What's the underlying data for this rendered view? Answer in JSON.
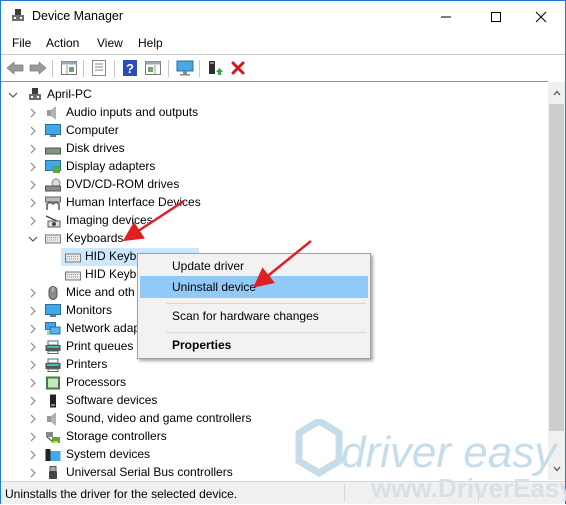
{
  "window": {
    "title": "Device Manager",
    "controls": {
      "minimize": "minimize-icon",
      "maximize": "maximize-icon",
      "close": "close-icon"
    }
  },
  "menubar": {
    "items": [
      "File",
      "Action",
      "View",
      "Help"
    ]
  },
  "toolbar": {
    "buttons": [
      {
        "icon": "back-arrow-icon",
        "tooltip": "Back"
      },
      {
        "icon": "forward-arrow-icon",
        "tooltip": "Forward"
      },
      {
        "icon": "show-hide-console-tree-icon",
        "tooltip": "Show/Hide Console Tree"
      },
      {
        "icon": "properties-icon",
        "tooltip": "Properties"
      },
      {
        "icon": "help-icon",
        "tooltip": "Help"
      },
      {
        "icon": "show-action-pane-icon",
        "tooltip": "Show/Hide Action Pane"
      },
      {
        "icon": "scan-hardware-icon",
        "tooltip": "Scan for hardware changes"
      },
      {
        "icon": "update-driver-icon",
        "tooltip": "Update driver"
      },
      {
        "icon": "uninstall-device-icon",
        "tooltip": "Uninstall device"
      }
    ]
  },
  "tree": {
    "root": {
      "label": "April-PC",
      "expanded": true,
      "icon": "computer-root-icon"
    },
    "categories": [
      {
        "label": "Audio inputs and outputs",
        "icon": "speaker-icon",
        "expanded": false
      },
      {
        "label": "Computer",
        "icon": "monitor-icon",
        "expanded": false
      },
      {
        "label": "Disk drives",
        "icon": "disk-drive-icon",
        "expanded": false
      },
      {
        "label": "Display adapters",
        "icon": "display-adapter-icon",
        "expanded": false
      },
      {
        "label": "DVD/CD-ROM drives",
        "icon": "dvd-drive-icon",
        "expanded": false
      },
      {
        "label": "Human Interface Devices",
        "icon": "hid-icon",
        "expanded": false
      },
      {
        "label": "Imaging devices",
        "icon": "camera-icon",
        "expanded": false
      },
      {
        "label": "Keyboards",
        "icon": "keyboard-icon",
        "expanded": true,
        "children": [
          {
            "label": "HID Keyboard Device",
            "visible_label": "HID Keyb",
            "icon": "keyboard-icon",
            "selected": true
          },
          {
            "label": "HID Keyboard Device",
            "visible_label": "HID Keyb",
            "icon": "keyboard-icon",
            "selected": false
          }
        ]
      },
      {
        "label": "Mice and other pointing devices",
        "visible_label": "Mice and oth",
        "icon": "mouse-icon",
        "expanded": false
      },
      {
        "label": "Monitors",
        "icon": "monitor-icon",
        "expanded": false
      },
      {
        "label": "Network adapters",
        "visible_label": "Network adap",
        "icon": "network-icon",
        "expanded": false
      },
      {
        "label": "Print queues",
        "icon": "printer-icon",
        "expanded": false
      },
      {
        "label": "Printers",
        "icon": "printer-icon",
        "expanded": false
      },
      {
        "label": "Processors",
        "icon": "processor-icon",
        "expanded": false
      },
      {
        "label": "Software devices",
        "icon": "software-device-icon",
        "expanded": false
      },
      {
        "label": "Sound, video and game controllers",
        "icon": "speaker-icon",
        "expanded": false
      },
      {
        "label": "Storage controllers",
        "icon": "storage-controller-icon",
        "expanded": false
      },
      {
        "label": "System devices",
        "icon": "system-folder-icon",
        "expanded": false
      },
      {
        "label": "Universal Serial Bus controllers",
        "icon": "usb-icon",
        "expanded": false
      }
    ]
  },
  "context_menu": {
    "items": [
      {
        "label": "Update driver",
        "highlighted": false,
        "bold": false
      },
      {
        "label": "Uninstall device",
        "highlighted": true,
        "bold": false
      },
      {
        "label": "Scan for hardware changes",
        "highlighted": false,
        "bold": false
      },
      {
        "label": "Properties",
        "highlighted": false,
        "bold": true
      }
    ]
  },
  "statusbar": {
    "text": "Uninstalls the driver for the selected device."
  },
  "watermark": {
    "brand": "driver easy",
    "url": "www.DriverEasy.com"
  },
  "annotations": {
    "arrow_color": "#e02020",
    "arrows": [
      "points-to-keyboards",
      "points-to-uninstall-device"
    ]
  },
  "colors": {
    "selection": "#cce8ff",
    "menu_highlight": "#91c9f7",
    "window_border": "#1e7ad6",
    "uninstall_x": "#d01818",
    "watermark": "#c5dcea"
  }
}
